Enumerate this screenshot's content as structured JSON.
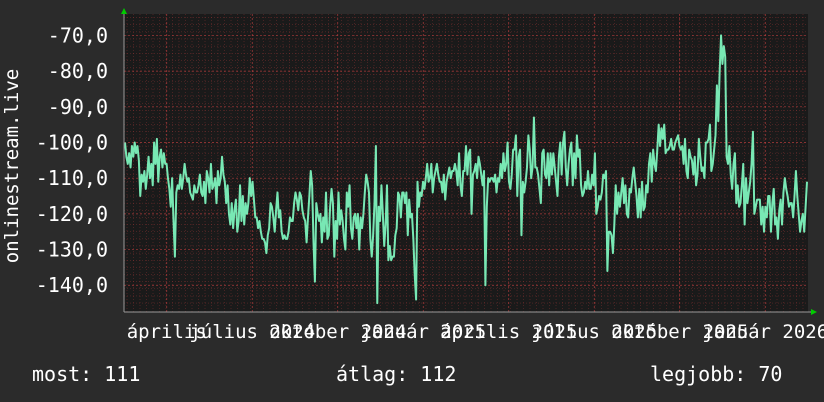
{
  "colors": {
    "background": "#2b2b2b",
    "plot_background": "#1a1a1a",
    "grid": "#c84040",
    "line": "#78e8b4",
    "axis": "#9a9a9a",
    "arrow": "#00cc00",
    "text": "#ffffff"
  },
  "stats": {
    "current": "most: 111",
    "average": "átlag: 112",
    "best": "legjobb: 70"
  },
  "chart_data": {
    "type": "line",
    "ylabel": "onlinestream.live",
    "ylim": [
      -147.5,
      -64
    ],
    "yticks": [
      "-70,0",
      "-80,0",
      "-90,0",
      "-100,0",
      "-110,0",
      "-120,0",
      "-130,0",
      "-140,0"
    ],
    "ytick_values": [
      -70,
      -80,
      -90,
      -100,
      -110,
      -120,
      -130,
      -140
    ],
    "xlabels": [
      "április",
      "július 2024",
      "október 2024",
      "január 2025",
      "április 2025",
      "július 2025",
      "október 2025",
      "január 2026"
    ],
    "grid": true,
    "series": [
      {
        "values": [
          -100,
          -104,
          -106,
          -103,
          -107,
          -101,
          -104,
          -100,
          -103,
          -101,
          -105,
          -115,
          -109,
          -111,
          -108,
          -113,
          -109,
          -104,
          -110,
          -106,
          -112,
          -100,
          -106,
          -99,
          -111,
          -104,
          -102,
          -107,
          -103,
          -106,
          -106,
          -110,
          -113,
          -118,
          -110,
          -122,
          -132,
          -114,
          -112,
          -113,
          -109,
          -113,
          -110,
          -106,
          -109,
          -111,
          -110,
          -114,
          -115,
          -116,
          -112,
          -114,
          -114,
          -112,
          -109,
          -114,
          -115,
          -111,
          -117,
          -108,
          -110,
          -114,
          -106,
          -113,
          -112,
          -110,
          -117,
          -108,
          -112,
          -110,
          -104,
          -109,
          -111,
          -117,
          -112,
          -120,
          -123,
          -117,
          -124,
          -119,
          -116,
          -125,
          -122,
          -112,
          -122,
          -115,
          -123,
          -117,
          -120,
          -117,
          -110,
          -115,
          -111,
          -116,
          -121,
          -121,
          -124,
          -122,
          -125,
          -127,
          -127,
          -128,
          -131,
          -126,
          -124,
          -117,
          -118,
          -121,
          -125,
          -119,
          -114,
          -121,
          -119,
          -125,
          -127,
          -126,
          -127,
          -127,
          -125,
          -121,
          -122,
          -122,
          -117,
          -114,
          -116,
          -119,
          -114,
          -115,
          -119,
          -121,
          -122,
          -128,
          -121,
          -115,
          -108,
          -112,
          -128,
          -139,
          -117,
          -120,
          -122,
          -120,
          -128,
          -121,
          -125,
          -114,
          -127,
          -126,
          -118,
          -113,
          -117,
          -132,
          -122,
          -127,
          -114,
          -123,
          -119,
          -122,
          -127,
          -130,
          -114,
          -118,
          -112,
          -124,
          -127,
          -121,
          -120,
          -124,
          -120,
          -130,
          -121,
          -124,
          -120,
          -114,
          -109,
          -111,
          -114,
          -127,
          -132,
          -126,
          -117,
          -101,
          -145,
          -118,
          -122,
          -112,
          -120,
          -129,
          -123,
          -112,
          -133,
          -129,
          -133,
          -132,
          -132,
          -126,
          -124,
          -114,
          -115,
          -121,
          -114,
          -114,
          -117,
          -114,
          -126,
          -116,
          -121,
          -120,
          -127,
          -137,
          -144,
          -111,
          -118,
          -114,
          -115,
          -111,
          -113,
          -110,
          -106,
          -111,
          -110,
          -106,
          -114,
          -110,
          -108,
          -106,
          -109,
          -111,
          -111,
          -114,
          -109,
          -116,
          -111,
          -109,
          -107,
          -110,
          -108,
          -108,
          -106,
          -108,
          -112,
          -103,
          -112,
          -115,
          -108,
          -108,
          -101,
          -109,
          -103,
          -102,
          -120,
          -109,
          -108,
          -106,
          -110,
          -104,
          -106,
          -109,
          -112,
          -108,
          -140,
          -118,
          -110,
          -111,
          -110,
          -110,
          -111,
          -109,
          -114,
          -110,
          -111,
          -106,
          -110,
          -103,
          -108,
          -106,
          -100,
          -111,
          -113,
          -109,
          -102,
          -102,
          -98,
          -115,
          -104,
          -102,
          -126,
          -111,
          -114,
          -111,
          -107,
          -98,
          -102,
          -110,
          -107,
          -93,
          -107,
          -107,
          -109,
          -113,
          -117,
          -103,
          -102,
          -109,
          -110,
          -103,
          -112,
          -103,
          -109,
          -103,
          -107,
          -111,
          -115,
          -104,
          -100,
          -109,
          -100,
          -97,
          -107,
          -112,
          -106,
          -102,
          -100,
          -112,
          -103,
          -110,
          -98,
          -104,
          -102,
          -112,
          -115,
          -114,
          -111,
          -113,
          -108,
          -113,
          -113,
          -109,
          -112,
          -103,
          -120,
          -118,
          -115,
          -116,
          -114,
          -109,
          -110,
          -108,
          -136,
          -125,
          -125,
          -126,
          -131,
          -123,
          -112,
          -120,
          -114,
          -118,
          -114,
          -110,
          -117,
          -112,
          -120,
          -121,
          -113,
          -114,
          -110,
          -107,
          -111,
          -115,
          -121,
          -113,
          -121,
          -111,
          -119,
          -118,
          -112,
          -114,
          -106,
          -103,
          -111,
          -102,
          -106,
          -108,
          -102,
          -95,
          -101,
          -96,
          -99,
          -95,
          -103,
          -102,
          -102,
          -101,
          -99,
          -102,
          -102,
          -100,
          -99,
          -98,
          -101,
          -102,
          -101,
          -106,
          -99,
          -108,
          -110,
          -102,
          -104,
          -105,
          -109,
          -104,
          -112,
          -109,
          -99,
          -104,
          -108,
          -107,
          -110,
          -100,
          -100,
          -99,
          -95,
          -108,
          -106,
          -102,
          -98,
          -84,
          -94,
          -80,
          -70,
          -78,
          -73,
          -76,
          -104,
          -106,
          -101,
          -109,
          -113,
          -106,
          -103,
          -117,
          -112,
          -118,
          -117,
          -112,
          -106,
          -123,
          -110,
          -117,
          -114,
          -111,
          -106,
          -97,
          -120,
          -118,
          -116,
          -116,
          -116,
          -123,
          -118,
          -125,
          -118,
          -121,
          -115,
          -115,
          -125,
          -117,
          -113,
          -123,
          -121,
          -127,
          -119,
          -116,
          -123,
          -114,
          -110,
          -113,
          -115,
          -118,
          -117,
          -117,
          -121,
          -115,
          -108,
          -115,
          -120,
          -125,
          -122,
          -120,
          -125,
          -118,
          -111
        ],
        "stroke_width": 2
      }
    ]
  }
}
